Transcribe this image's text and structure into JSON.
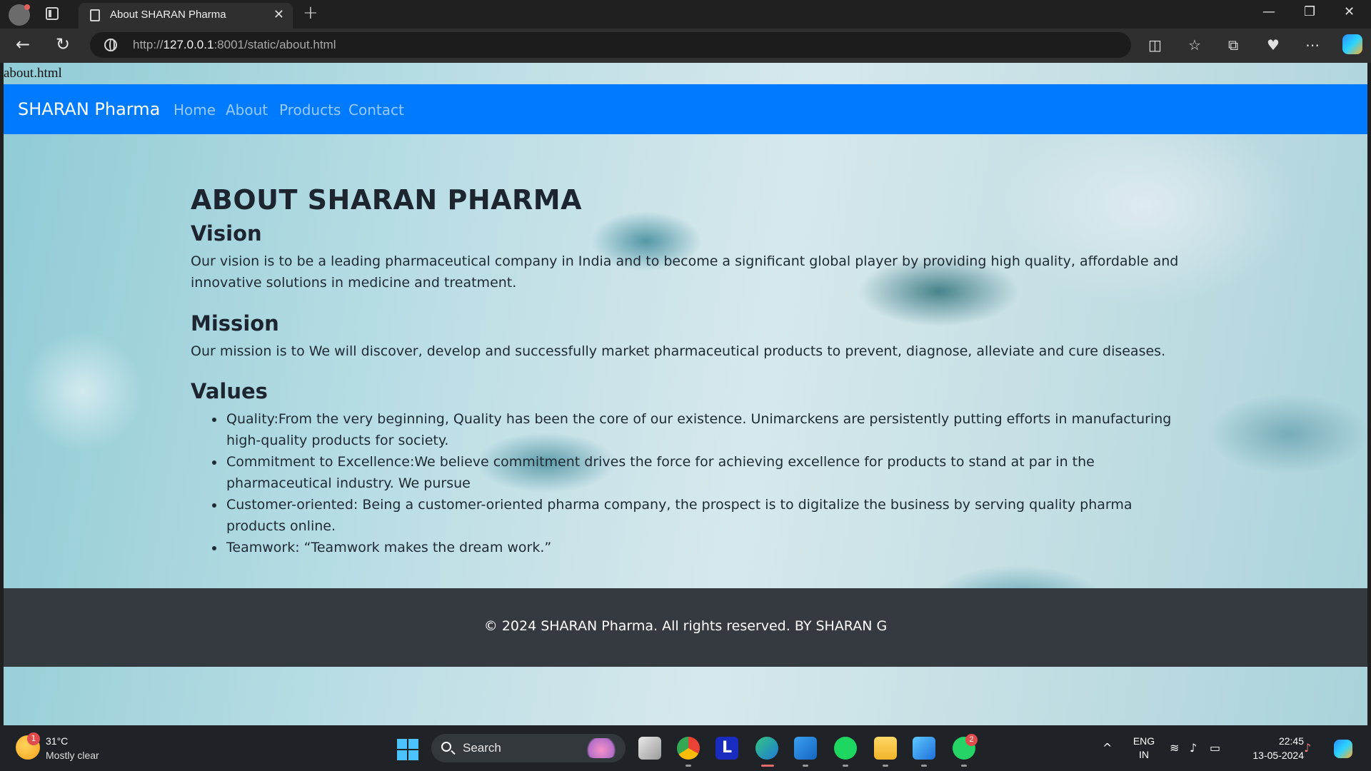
{
  "browser": {
    "tab_title": "About SHARAN Pharma",
    "url_prefix": "http://",
    "url_host": "127.0.0.1",
    "url_rest": ":8001/static/about.html"
  },
  "page": {
    "file_label": "about.html",
    "brand": "SHARAN Pharma",
    "nav": [
      "Home",
      "About",
      "Products",
      "Contact"
    ],
    "heading": "ABOUT SHARAN PHARMA",
    "vision_title": "Vision",
    "vision_text": "Our vision is to be a leading pharmaceutical company in India and to become a significant global player by providing high quality, affordable and innovative solutions in medicine and treatment.",
    "mission_title": "Mission",
    "mission_text": "Our mission is to We will discover, develop and successfully market pharmaceutical products to prevent, diagnose, alleviate and cure diseases.",
    "values_title": "Values",
    "values": [
      "Quality:From the very beginning, Quality has been the core of our existence. Unimarckens are persistently putting efforts in manufacturing high-quality products for society.",
      "Commitment to Excellence:We believe commitment drives the force for achieving excellence for products to stand at par in the pharmaceutical industry. We pursue",
      "Customer-oriented: Being a customer-oriented pharma company, the prospect is to digitalize the business by serving quality pharma products online.",
      "Teamwork: “Teamwork makes the dream work.”"
    ],
    "footer": "© 2024 SHARAN Pharma. All rights reserved. BY SHARAN G"
  },
  "taskbar": {
    "weather_badge": "1",
    "weather_temp": "31°C",
    "weather_desc": "Mostly clear",
    "search_label": "Search",
    "whatsapp_badge": "2",
    "lang_line1": "ENG",
    "lang_line2": "IN",
    "time": "22:45",
    "date": "13-05-2024"
  },
  "colors": {
    "navbar": "#007bff",
    "footer": "#343a40",
    "text": "#1d2530"
  }
}
